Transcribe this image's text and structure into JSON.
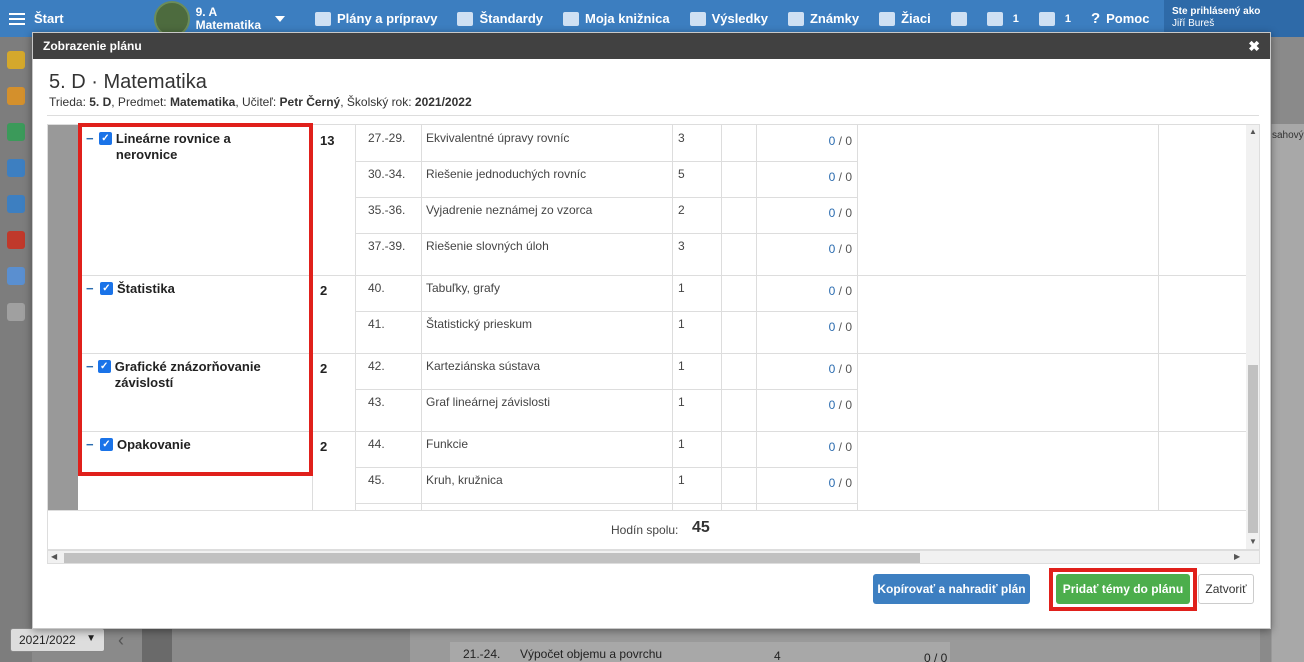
{
  "topbar": {
    "home": "Štart",
    "class_name": "9. A",
    "class_subject": "Matematika",
    "nav": [
      "Plány a prípravy",
      "Štandardy",
      "Moja knižnica",
      "Výsledky",
      "Známky",
      "Žiaci"
    ],
    "chat_count": "1",
    "mail_count": "1",
    "help": "Pomoc",
    "user_label": "Ste prihlásený ako",
    "user_name": "Jiří Bureš"
  },
  "background": {
    "year": "2021/2022",
    "right_header": "sahový",
    "row_range": "21.-24.",
    "row_topic": "Výpočet objemu a povrchu",
    "row_count": "4",
    "row_score": "0 / 0"
  },
  "modal": {
    "header": "Zobrazenie plánu",
    "title": "5. D · Matematika",
    "sub": {
      "trieda_label": "Trieda: ",
      "trieda": "5. D",
      "predmet_label": ", Predmet: ",
      "predmet": "Matematika",
      "ucitel_label": ", Učiteľ: ",
      "ucitel": "Petr Černý",
      "rok_label": ", Školský rok: ",
      "rok": "2021/2022"
    },
    "topics": [
      {
        "name": "Lineárne rovnice a nerovnice",
        "hours": "13"
      },
      {
        "name": "Štatistika",
        "hours": "2"
      },
      {
        "name": "Grafické znázorňovanie závislostí",
        "hours": "2"
      },
      {
        "name": "Opakovanie",
        "hours": "2"
      }
    ],
    "rows": [
      {
        "range": "27.-29.",
        "lesson": "Ekvivalentné úpravy rovníc",
        "count": "3",
        "done": "0",
        "total": "0"
      },
      {
        "range": "30.-34.",
        "lesson": "Riešenie jednoduchých rovníc",
        "count": "5",
        "done": "0",
        "total": "0"
      },
      {
        "range": "35.-36.",
        "lesson": "Vyjadrenie neznámej zo vzorca",
        "count": "2",
        "done": "0",
        "total": "0"
      },
      {
        "range": "37.-39.",
        "lesson": "Riešenie slovných úloh",
        "count": "3",
        "done": "0",
        "total": "0"
      },
      {
        "range": "40.",
        "lesson": "Tabuľky, grafy",
        "count": "1",
        "done": "0",
        "total": "0"
      },
      {
        "range": "41.",
        "lesson": "Štatistický prieskum",
        "count": "1",
        "done": "0",
        "total": "0"
      },
      {
        "range": "42.",
        "lesson": "Karteziánska sústava",
        "count": "1",
        "done": "0",
        "total": "0"
      },
      {
        "range": "43.",
        "lesson": "Graf lineárnej závislosti",
        "count": "1",
        "done": "0",
        "total": "0"
      },
      {
        "range": "44.",
        "lesson": "Funkcie",
        "count": "1",
        "done": "0",
        "total": "0"
      },
      {
        "range": "45.",
        "lesson": "Kruh, kružnica",
        "count": "1",
        "done": "0",
        "total": "0"
      }
    ],
    "total_label": "Hodín spolu:",
    "total_value": "45",
    "buttons": {
      "copy": "Kopírovať a nahradiť plán",
      "add": "Pridať témy do plánu",
      "close": "Zatvoriť"
    }
  }
}
